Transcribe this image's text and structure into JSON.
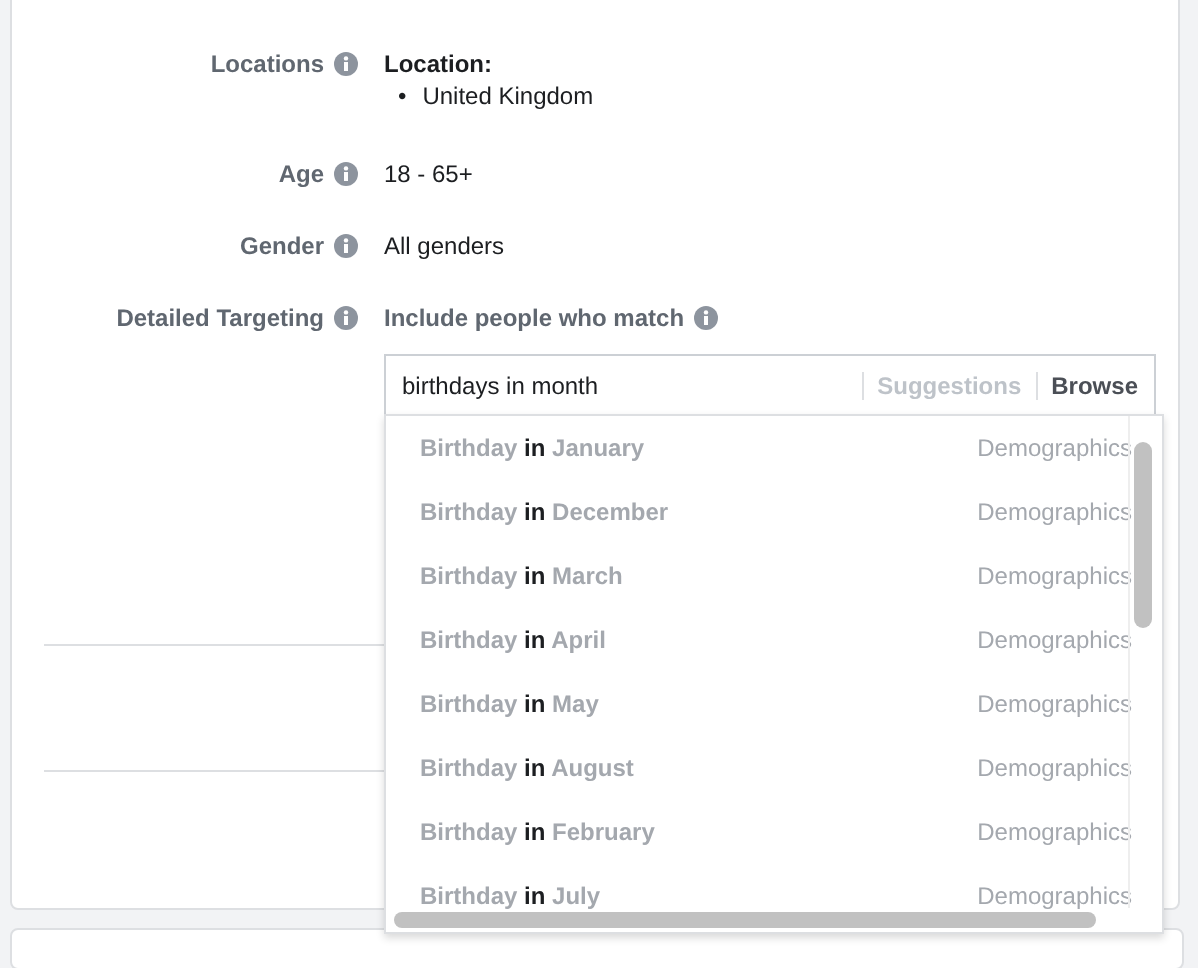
{
  "targeting": [
    {
      "label": "Locations",
      "kind": "location",
      "heading": "Location:",
      "marker": "•",
      "items": [
        "United Kingdom"
      ]
    },
    {
      "label": "Age",
      "kind": "text",
      "value": "18 - 65+"
    },
    {
      "label": "Gender",
      "kind": "text",
      "value": "All genders"
    },
    {
      "label": "Detailed Targeting",
      "kind": "detailed",
      "value": "Include people who match"
    }
  ],
  "search": {
    "value": "birthdays in month",
    "tabs": [
      {
        "label": "Suggestions",
        "selected": false
      },
      {
        "label": "Browse",
        "selected": true
      }
    ]
  },
  "results": [
    {
      "title": "Birthday *in* January",
      "category": "Demographics"
    },
    {
      "title": "Birthday *in* December",
      "category": "Demographics"
    },
    {
      "title": "Birthday *in* March",
      "category": "Demographics"
    },
    {
      "title": "Birthday *in* April",
      "category": "Demographics"
    },
    {
      "title": "Birthday *in* May",
      "category": "Demographics"
    },
    {
      "title": "Birthday *in* August",
      "category": "Demographics"
    },
    {
      "title": "Birthday *in* February",
      "category": "Demographics"
    },
    {
      "title": "Birthday *in* July",
      "category": "Demographics"
    }
  ]
}
